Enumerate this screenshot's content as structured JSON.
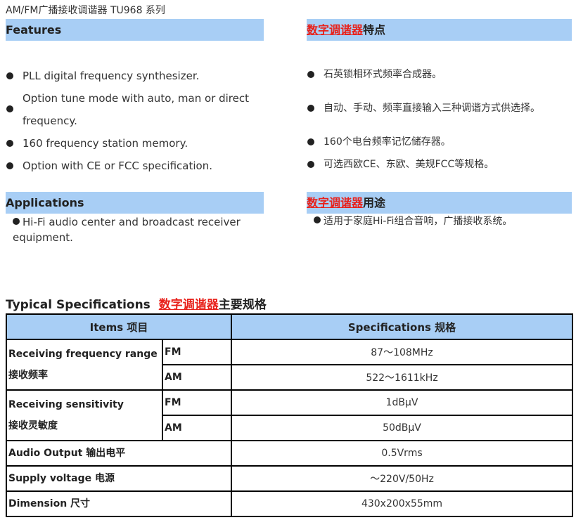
{
  "page_title": "AM/FM广播接收调谐器    TU968 系列",
  "features": {
    "heading": "Features",
    "items": [
      "PLL digital frequency synthesizer.",
      "Option tune mode with auto, man or direct frequency.",
      "160 frequency station memory.",
      "Option with CE or FCC specification."
    ]
  },
  "features_cn": {
    "heading_link": "数字调谐器",
    "heading_rest": "特点",
    "items": [
      "石英锁相环式频率合成器。",
      "自动、手动、频率直接输入三种调谐方式供选择。",
      "160个电台频率记忆储存器。",
      "可选西欧CE、东欧、美规FCC等规格。"
    ]
  },
  "applications": {
    "heading": "Applications",
    "text": "Hi-Fi audio center and broadcast receiver equipment."
  },
  "applications_cn": {
    "heading_link": "数字调谐器",
    "heading_rest": "用途",
    "text": "适用于家庭Hi-Fi组合音响，广播接收系统。"
  },
  "typical_specs": {
    "heading": "Typical Specifications",
    "heading_link": "数字调谐器",
    "heading_rest": "主要规格"
  },
  "table": {
    "header_items": "Items  项目",
    "header_specs": "Specifications  规格",
    "rows": [
      {
        "item_en": "Receiving frequency range",
        "item_cn": "接收频率",
        "bands": [
          {
            "band": "FM",
            "value": "87～108MHz"
          },
          {
            "band": "AM",
            "value": "522～1611kHz"
          }
        ]
      },
      {
        "item_en": "Receiving sensitivity",
        "item_cn": "接收灵敏度",
        "bands": [
          {
            "band": "FM",
            "value": "1dBμV"
          },
          {
            "band": "AM",
            "value": "50dBμV"
          }
        ]
      }
    ],
    "simple_rows": [
      {
        "item": "Audio Output 输出电平",
        "value": "0.5Vrms"
      },
      {
        "item": "Supply voltage 电源",
        "value": "～220V/50Hz"
      },
      {
        "item": "Dimension 尺寸",
        "value": "430x200x55mm"
      }
    ]
  },
  "colors": {
    "header_bar": "#a8cef5",
    "link_red": "#e8211b"
  }
}
